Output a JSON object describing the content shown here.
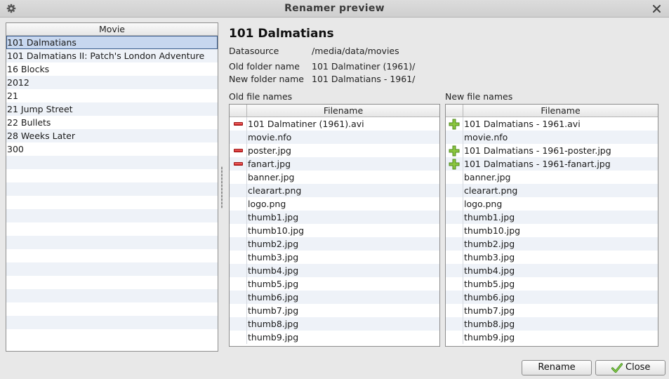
{
  "window": {
    "title": "Renamer preview"
  },
  "movies": {
    "header": "Movie",
    "items": [
      "101 Dalmatians",
      "101 Dalmatians II: Patch's London Adventure",
      "16 Blocks",
      "2012",
      "21",
      "21 Jump Street",
      "22 Bullets",
      "28 Weeks Later",
      "300"
    ],
    "selected_index": 0,
    "empty_rows": 14
  },
  "details": {
    "title": "101 Dalmatians",
    "datasource_label": "Datasource",
    "datasource_value": "/media/data/movies",
    "old_folder_label": "Old folder name",
    "old_folder_value": "101 Dalmatiner (1961)/",
    "new_folder_label": "New folder name",
    "new_folder_value": "101 Dalmatians - 1961/"
  },
  "old_files": {
    "label": "Old file names",
    "header": "Filename",
    "rows": [
      {
        "name": "101 Dalmatiner (1961).avi",
        "icon": "minus-icon"
      },
      {
        "name": "movie.nfo",
        "icon": ""
      },
      {
        "name": "poster.jpg",
        "icon": "minus-icon"
      },
      {
        "name": "fanart.jpg",
        "icon": "minus-icon"
      },
      {
        "name": "banner.jpg",
        "icon": ""
      },
      {
        "name": "clearart.png",
        "icon": ""
      },
      {
        "name": "logo.png",
        "icon": ""
      },
      {
        "name": "thumb1.jpg",
        "icon": ""
      },
      {
        "name": "thumb10.jpg",
        "icon": ""
      },
      {
        "name": "thumb2.jpg",
        "icon": ""
      },
      {
        "name": "thumb3.jpg",
        "icon": ""
      },
      {
        "name": "thumb4.jpg",
        "icon": ""
      },
      {
        "name": "thumb5.jpg",
        "icon": ""
      },
      {
        "name": "thumb6.jpg",
        "icon": ""
      },
      {
        "name": "thumb7.jpg",
        "icon": ""
      },
      {
        "name": "thumb8.jpg",
        "icon": ""
      },
      {
        "name": "thumb9.jpg",
        "icon": ""
      }
    ]
  },
  "new_files": {
    "label": "New file names",
    "header": "Filename",
    "rows": [
      {
        "name": "101 Dalmatians - 1961.avi",
        "icon": "plus-icon"
      },
      {
        "name": "movie.nfo",
        "icon": ""
      },
      {
        "name": "101 Dalmatians - 1961-poster.jpg",
        "icon": "plus-icon"
      },
      {
        "name": "101 Dalmatians - 1961-fanart.jpg",
        "icon": "plus-icon"
      },
      {
        "name": "banner.jpg",
        "icon": ""
      },
      {
        "name": "clearart.png",
        "icon": ""
      },
      {
        "name": "logo.png",
        "icon": ""
      },
      {
        "name": "thumb1.jpg",
        "icon": ""
      },
      {
        "name": "thumb10.jpg",
        "icon": ""
      },
      {
        "name": "thumb2.jpg",
        "icon": ""
      },
      {
        "name": "thumb3.jpg",
        "icon": ""
      },
      {
        "name": "thumb4.jpg",
        "icon": ""
      },
      {
        "name": "thumb5.jpg",
        "icon": ""
      },
      {
        "name": "thumb6.jpg",
        "icon": ""
      },
      {
        "name": "thumb7.jpg",
        "icon": ""
      },
      {
        "name": "thumb8.jpg",
        "icon": ""
      },
      {
        "name": "thumb9.jpg",
        "icon": ""
      }
    ]
  },
  "buttons": {
    "rename": "Rename",
    "close": "Close"
  },
  "icons": {
    "window_menu": "gear-icon",
    "window_close": "close-icon",
    "removed": "minus-icon",
    "added": "plus-icon",
    "confirm": "checkmark-icon"
  },
  "colors": {
    "selection": "#c7d7ef",
    "stripe": "#eef2f8",
    "removed": "#d42a2a",
    "added": "#7dbf2a"
  }
}
